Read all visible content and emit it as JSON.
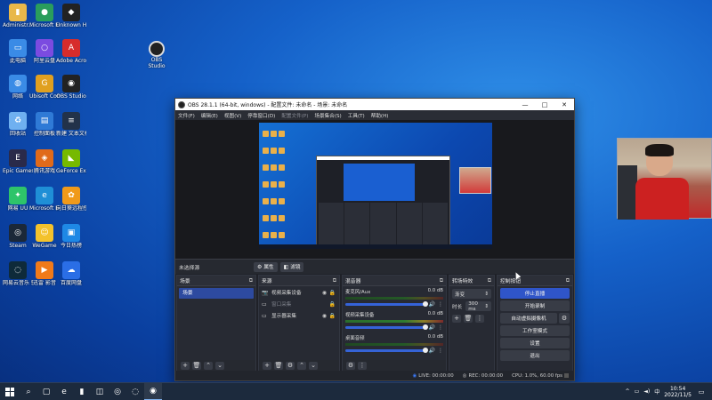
{
  "desktop": {
    "icons": [
      {
        "label": "Administr...",
        "icon": "folder-icon",
        "color": "#e8b84a",
        "glyph": "▮"
      },
      {
        "label": "Microsoft Edge",
        "icon": "edge-like-icon",
        "color": "#2a9d5c",
        "glyph": "●"
      },
      {
        "label": "Unknown Horizon",
        "icon": "game-icon",
        "color": "#222222",
        "glyph": "◆"
      },
      {
        "label": "此电脑",
        "icon": "computer-icon",
        "color": "#3a8be6",
        "glyph": "▭"
      },
      {
        "label": "阿里云盘",
        "icon": "cloud-drive-icon",
        "color": "#7b4be0",
        "glyph": "○"
      },
      {
        "label": "Adobe Acrobat",
        "icon": "acrobat-icon",
        "color": "#d72c2c",
        "glyph": "A"
      },
      {
        "label": "网络",
        "icon": "network-icon",
        "color": "#3a8be6",
        "glyph": "◍"
      },
      {
        "label": "Ubisoft Connect",
        "icon": "game-folder-icon",
        "color": "#e0a020",
        "glyph": "G"
      },
      {
        "label": "OBS Studio",
        "icon": "obs-icon",
        "color": "#222222",
        "glyph": "◉"
      },
      {
        "label": "回收站",
        "icon": "recycle-bin-icon",
        "color": "#6fb0f0",
        "glyph": "♻"
      },
      {
        "label": "控制面板",
        "icon": "control-panel-icon",
        "color": "#2f7ad6",
        "glyph": "▤"
      },
      {
        "label": "新建 文本文档",
        "icon": "text-file-icon",
        "color": "#22324a",
        "glyph": "≡"
      },
      {
        "label": "Epic Games",
        "icon": "epic-icon",
        "color": "#2a2a4a",
        "glyph": "E"
      },
      {
        "label": "腾讯游戏",
        "icon": "tencent-game-icon",
        "color": "#e06a1a",
        "glyph": "◈"
      },
      {
        "label": "GeForce Experience",
        "icon": "nvidia-icon",
        "color": "#76b900",
        "glyph": "◣"
      },
      {
        "label": "网易 UU",
        "icon": "uu-icon",
        "color": "#2ec46a",
        "glyph": "✦"
      },
      {
        "label": "Microsoft Edge",
        "icon": "edge-icon",
        "color": "#1f8fd6",
        "glyph": "e"
      },
      {
        "label": "向日葵远程控制",
        "icon": "sunflower-icon",
        "color": "#f09a1a",
        "glyph": "✿"
      },
      {
        "label": "Steam",
        "icon": "steam-icon",
        "color": "#1b2838",
        "glyph": "◎"
      },
      {
        "label": "WeGame",
        "icon": "wegame-icon",
        "color": "#f3c22c",
        "glyph": "☺"
      },
      {
        "label": "今日热榜",
        "icon": "news-icon",
        "color": "#1e88e5",
        "glyph": "▣"
      },
      {
        "label": "网易云音乐 驱动",
        "icon": "music-icon",
        "color": "#0e2a3a",
        "glyph": "◌"
      },
      {
        "label": "迅雷 影音",
        "icon": "player-icon",
        "color": "#f07a1a",
        "glyph": "▶"
      },
      {
        "label": "百度网盘",
        "icon": "baidu-netdisk-icon",
        "color": "#2a6ee6",
        "glyph": "☁"
      }
    ],
    "obs_shortcut_label": "OBS Studio"
  },
  "obs": {
    "title": "OBS 28.1.1 (64-bit, windows) - 配置文件: 未命名 - 场景: 未命名",
    "window_controls": {
      "minimize": "—",
      "maximize": "□",
      "close": "✕"
    },
    "menu": [
      {
        "label": "文件(F)",
        "dim": false
      },
      {
        "label": "编辑(E)",
        "dim": false
      },
      {
        "label": "视图(V)",
        "dim": false
      },
      {
        "label": "停靠窗口(D)",
        "dim": false
      },
      {
        "label": "配置文件(P)",
        "dim": true
      },
      {
        "label": "场景集合(S)",
        "dim": false
      },
      {
        "label": "工具(T)",
        "dim": false
      },
      {
        "label": "帮助(H)",
        "dim": false
      }
    ],
    "source_toolbar": {
      "no_source": "未选择源",
      "properties": "属性",
      "filters": "滤镜"
    },
    "scenes_dock": {
      "title": "场景",
      "items": [
        "场景"
      ]
    },
    "sources_dock": {
      "title": "来源",
      "items": [
        {
          "name": "视频采集设备",
          "icon": "camera-icon",
          "hidden": false
        },
        {
          "name": "窗口采集",
          "icon": "window-icon",
          "hidden": true
        },
        {
          "name": "显示器采集",
          "icon": "monitor-icon",
          "hidden": false
        }
      ]
    },
    "mixer_dock": {
      "title": "混音器",
      "channels": [
        {
          "name": "麦克风/Aux",
          "db": "0.0 dB"
        },
        {
          "name": "视频采集设备",
          "db": "0.0 dB"
        },
        {
          "name": "桌面音频",
          "db": "0.0 dB"
        }
      ]
    },
    "transitions_dock": {
      "title": "转场特效",
      "selected": "渐变",
      "duration_label": "时长",
      "duration_value": "300 ms"
    },
    "controls_dock": {
      "title": "控制按钮",
      "buttons": [
        "停止直播",
        "开始录制",
        "自动虚拟摄像机",
        "工作室模式",
        "设置",
        "退出"
      ]
    },
    "statusbar": {
      "live": "LIVE: 00:00:00",
      "rec": "REC: 00:00:00",
      "cpu": "CPU: 1.0%, 60.00 fps"
    }
  },
  "taskbar": {
    "apps": [
      {
        "icon": "search-icon",
        "glyph": "⌕",
        "active": false
      },
      {
        "icon": "task-view-icon",
        "glyph": "▢",
        "active": false
      },
      {
        "icon": "edge-icon",
        "glyph": "e",
        "active": false
      },
      {
        "icon": "file-explorer-icon",
        "glyph": "▮",
        "active": false
      },
      {
        "icon": "store-icon",
        "glyph": "◫",
        "active": false
      },
      {
        "icon": "steam-icon",
        "glyph": "◎",
        "active": false
      },
      {
        "icon": "music-icon",
        "glyph": "◌",
        "active": false
      },
      {
        "icon": "obs-icon",
        "glyph": "◉",
        "active": true
      }
    ],
    "tray": {
      "chevron": "^",
      "network": "▭",
      "volume": "◄)",
      "lang": "中"
    },
    "time": "10:54",
    "date": "2022/11/5"
  }
}
